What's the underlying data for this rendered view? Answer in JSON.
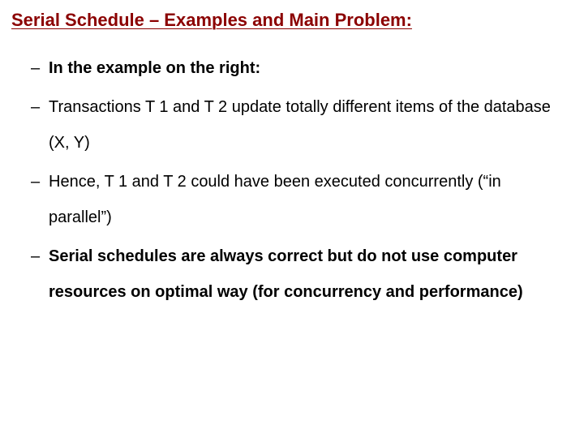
{
  "title": "Serial Schedule – Examples and Main Problem:",
  "bullets": [
    {
      "text": "In the example on the right:",
      "bold": true
    },
    {
      "text": "Transactions T 1 and T 2 update totally different items of the database (X, Y)",
      "bold": false
    },
    {
      "text": "Hence, T 1 and T 2 could have been executed concurrently (“in parallel”)",
      "bold": false
    },
    {
      "text": "Serial schedules are always correct but do not use computer resources on optimal way (for concurrency and performance)",
      "bold": true
    }
  ]
}
